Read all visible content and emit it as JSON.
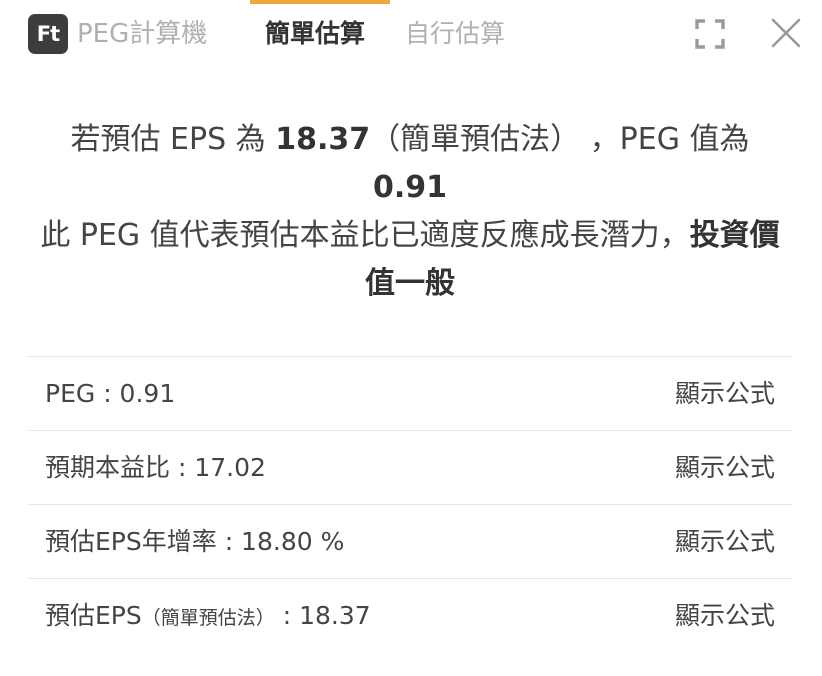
{
  "header": {
    "logo_text": "Ft",
    "app_title": "PEG計算機",
    "tabs": [
      {
        "label": "簡單估算",
        "active": true
      },
      {
        "label": "自行估算",
        "active": false
      }
    ],
    "accent_color": "#f0a83c"
  },
  "summary": {
    "part1": "若預估 EPS 為 ",
    "eps_value": "18.37",
    "part2": "（簡單預估法） ，PEG 值為 ",
    "peg_value": "0.91",
    "part3": "此 PEG 值代表預估本益比已適度反應成長潛力，",
    "verdict": "投資價值一般"
  },
  "rows": [
    {
      "label": "PEG : 0.91",
      "link": "顯示公式"
    },
    {
      "label": "預期本益比 : 17.02",
      "link": "顯示公式"
    },
    {
      "label": "預估EPS年增率 : 18.80 %",
      "link": "顯示公式"
    },
    {
      "label_main": "預估EPS",
      "label_note": "（簡單預估法）",
      "label_value": " : 18.37",
      "link": "顯示公式"
    }
  ]
}
